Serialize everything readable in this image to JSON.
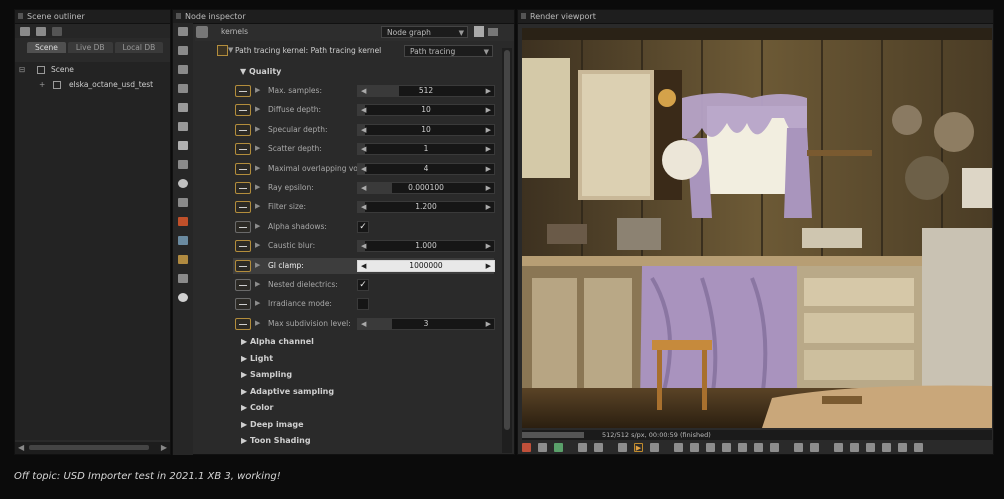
{
  "outliner": {
    "title": "Scene outliner",
    "tabs": [
      {
        "label": "Scene",
        "active": true
      },
      {
        "label": "Live DB",
        "active": false
      },
      {
        "label": "Local DB",
        "active": false
      }
    ],
    "tree": [
      {
        "label": "Scene",
        "level": 0,
        "expander": "⊟"
      },
      {
        "label": "elska_octane_usd_test",
        "level": 1,
        "expander": "+"
      }
    ]
  },
  "inspector": {
    "title": "Node inspector",
    "top_label": "kernels",
    "graph_combo": "Node graph",
    "kernel_label": "Path tracing kernel: Path tracing kernel",
    "kernel_combo": "Path tracing",
    "section_quality": "▼ Quality",
    "params": [
      {
        "label": "Max. samples:",
        "type": "slider",
        "value": "512",
        "fill": 0.3
      },
      {
        "label": "Diffuse depth:",
        "type": "slider",
        "value": "10",
        "fill": 0.05
      },
      {
        "label": "Specular depth:",
        "type": "slider",
        "value": "10",
        "fill": 0.05
      },
      {
        "label": "Scatter depth:",
        "type": "slider",
        "value": "1",
        "fill": 0.05
      },
      {
        "label": "Maximal overlapping volumes:",
        "type": "slider",
        "value": "4",
        "fill": 0.05
      },
      {
        "label": "Ray epsilon:",
        "type": "slider",
        "value": "0.000100",
        "fill": 0.25
      },
      {
        "label": "Filter size:",
        "type": "slider",
        "value": "1.200",
        "fill": 0.05
      },
      {
        "label": "Alpha shadows:",
        "type": "check",
        "checked": true
      },
      {
        "label": "Caustic blur:",
        "type": "slider",
        "value": "1.000",
        "fill": 0.05
      },
      {
        "label": "GI clamp:",
        "type": "slider",
        "value": "1000000",
        "fill": 1.0,
        "highlight": true
      },
      {
        "label": "Nested dielectrics:",
        "type": "check",
        "checked": true
      },
      {
        "label": "Irradiance mode:",
        "type": "check",
        "checked": false
      },
      {
        "label": "Max subdivision level:",
        "type": "slider",
        "value": "3",
        "fill": 0.25
      }
    ],
    "collapsed_sections": [
      "▶ Alpha channel",
      "▶ Light",
      "▶ Sampling",
      "▶ Adaptive sampling",
      "▶ Color",
      "▶ Deep image",
      "▶ Toon Shading"
    ]
  },
  "viewport": {
    "title": "Render viewport",
    "status": "512/512 s/px, 00:00:59 (finished)",
    "progress": 1.0
  },
  "caption": "Off topic: USD Importer test in 2021.1 XB 3, working!"
}
